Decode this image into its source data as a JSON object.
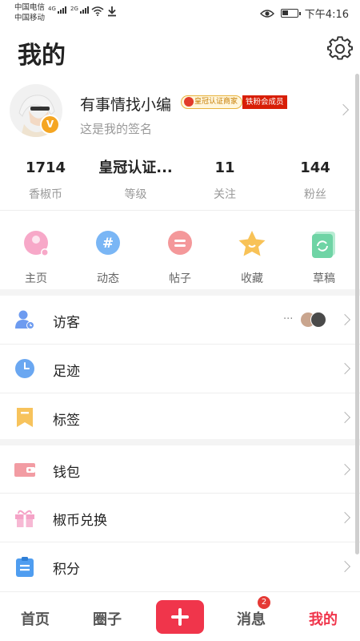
{
  "status_bar": {
    "carrier1": "中国电信",
    "carrier2": "中国移动",
    "net1": "4G",
    "net2": "2G",
    "time": "下午4:16"
  },
  "header": {
    "title": "我的",
    "settings_icon": "gear-icon"
  },
  "profile": {
    "name": "有事情找小编",
    "badge_crown": "皇冠认证商家",
    "badge_fan": "铁粉会成员",
    "signature": "这是我的签名",
    "verified_badge": "V"
  },
  "stats": [
    {
      "value": "1714",
      "label": "香椒币"
    },
    {
      "value": "皇冠认证...",
      "label": "等级"
    },
    {
      "value": "11",
      "label": "关注"
    },
    {
      "value": "144",
      "label": "粉丝"
    }
  ],
  "quick_actions": [
    {
      "label": "主页",
      "icon": "home-icon",
      "color": "#f7a8c8"
    },
    {
      "label": "动态",
      "icon": "hashtag-icon",
      "color": "#7ab6f5"
    },
    {
      "label": "帖子",
      "icon": "post-icon",
      "color": "#f4989a"
    },
    {
      "label": "收藏",
      "icon": "star-icon",
      "color": "#f8c257"
    },
    {
      "label": "草稿",
      "icon": "draft-icon",
      "color": "#6fd4a5"
    }
  ],
  "menu_group1": [
    {
      "label": "访客",
      "icon": "visitor-icon",
      "color": "#6d9bf0"
    },
    {
      "label": "足迹",
      "icon": "clock-icon",
      "color": "#6aa7f1"
    },
    {
      "label": "标签",
      "icon": "bookmark-icon",
      "color": "#f7c35c"
    }
  ],
  "visitors_more": "···",
  "menu_group2": [
    {
      "label": "钱包",
      "icon": "wallet-icon",
      "color": "#f29ca3"
    },
    {
      "label": "椒币兑换",
      "icon": "gift-icon",
      "color": "#f5a3c7"
    },
    {
      "label": "积分",
      "icon": "clipboard-icon",
      "color": "#4f9df0"
    }
  ],
  "bottom_nav": {
    "home": "首页",
    "circle": "圈子",
    "messages": "消息",
    "messages_badge": "2",
    "mine": "我的",
    "active_color": "#f0354b"
  }
}
